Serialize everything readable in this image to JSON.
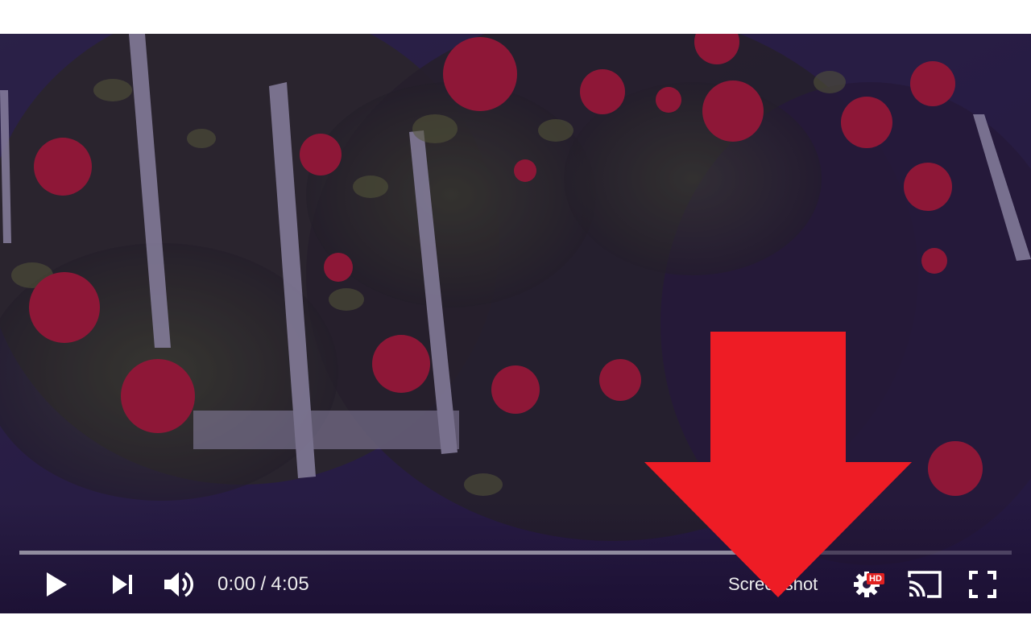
{
  "player": {
    "current_time": "0:00",
    "separator": "/",
    "duration": "4:05",
    "progress_played_fraction": 0.0,
    "progress_loaded_fraction": 0.78,
    "screenshot_label": "Screenshot",
    "hd_badge": "HD"
  },
  "icons": {
    "play": "play-icon",
    "next": "next-icon",
    "volume": "volume-icon",
    "settings": "gear-icon",
    "cast": "cast-icon",
    "fullscreen": "fullscreen-icon",
    "annotation": "arrow-down-icon"
  },
  "colors": {
    "progress_played": "#ff0000",
    "progress_loaded": "#c8c8d2",
    "annotation_arrow": "#ee1c25",
    "hd_badge": "#e02020",
    "control_text": "#eeeeee"
  }
}
